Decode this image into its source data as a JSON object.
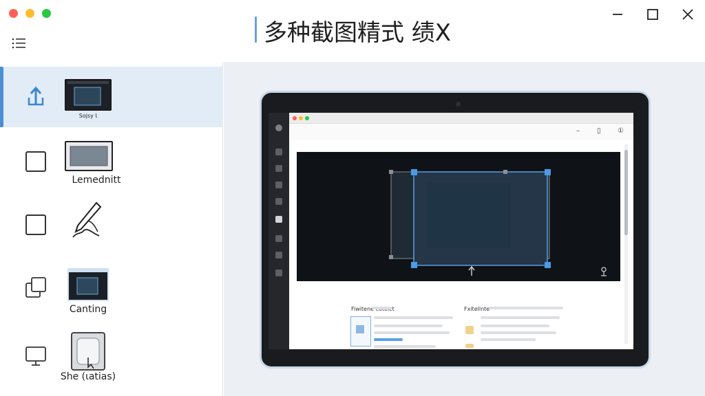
{
  "window": {
    "title": "多种截图精式 绩X",
    "controls": {
      "minimize_icon": "minimize-icon",
      "maximize_icon": "maximize-icon",
      "close_icon": "close-icon"
    }
  },
  "colors": {
    "accent": "#4a8ed4",
    "sidebar_active_bg": "#e2ecf7",
    "preview_bg": "#eceff3",
    "traffic_red": "#ff5f57",
    "traffic_yellow": "#febc2e",
    "traffic_green": "#28c840"
  },
  "sidebar": {
    "menu_icon": "list-icon",
    "items": [
      {
        "icon": "upload-icon",
        "label": "Sojsy Ɩ",
        "active": true
      },
      {
        "icon": "square-icon",
        "label": "Lemednitt",
        "active": false
      },
      {
        "icon": "square-icon",
        "label": "",
        "active": false
      },
      {
        "icon": "multi-window-icon",
        "label": "Canting",
        "active": false
      },
      {
        "icon": "monitor-icon",
        "label": "She (ɩatias)",
        "active": false
      }
    ]
  },
  "preview": {
    "toolbar_glyphs": [
      "–",
      "▯",
      "①"
    ],
    "doc_sections": [
      {
        "heading": "Fiwitene cotelct"
      },
      {
        "heading": "Fxitellnte"
      }
    ]
  }
}
